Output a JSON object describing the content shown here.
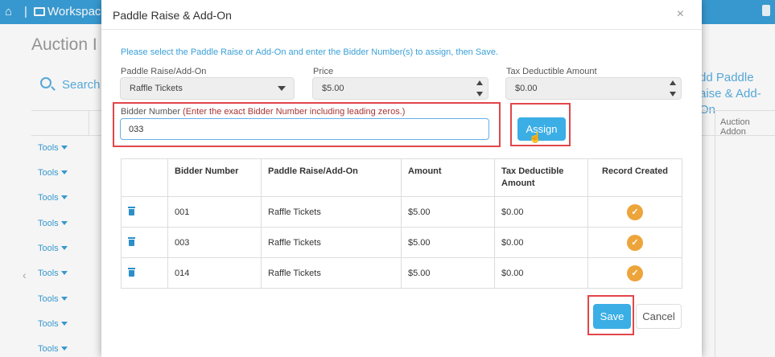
{
  "background": {
    "workspace_label": "Workspace",
    "page_title": "Auction I",
    "search_label": "Search",
    "add_button_line1": "dd Paddle",
    "add_button_line2": "aise & Add-On",
    "column_header": "Auction Addon",
    "tools_label": "Tools"
  },
  "modal": {
    "title": "Paddle Raise & Add-On",
    "close_glyph": "×",
    "instructions": "Please select the Paddle Raise or Add-On and enter the Bidder Number(s) to assign, then Save.",
    "paddle_label": "Paddle Raise/Add-On",
    "paddle_value": "Raffle Tickets",
    "price_label": "Price",
    "price_value": "$5.00",
    "tax_label": "Tax Deductible Amount",
    "tax_value": "$0.00",
    "bidder_label": "Bidder Number",
    "bidder_hint": "(Enter the exact Bidder Number including leading zeros.)",
    "bidder_value": "033",
    "assign_label": "Assign",
    "save_label": "Save",
    "cancel_label": "Cancel"
  },
  "table": {
    "headers": [
      "",
      "Bidder Number",
      "Paddle Raise/Add-On",
      "Amount",
      "Tax Deductible Amount",
      "Record Created"
    ],
    "rows": [
      {
        "bidder": "001",
        "item": "Raffle Tickets",
        "amount": "$5.00",
        "tax": "$0.00"
      },
      {
        "bidder": "003",
        "item": "Raffle Tickets",
        "amount": "$5.00",
        "tax": "$0.00"
      },
      {
        "bidder": "014",
        "item": "Raffle Tickets",
        "amount": "$5.00",
        "tax": "$0.00"
      }
    ]
  },
  "icons": {
    "delete": "trash-icon",
    "record_created": "check-circle-icon",
    "check_glyph": "✓"
  },
  "colors": {
    "accent": "#3aaee5",
    "highlight": "#e1464a",
    "check": "#eda43a"
  }
}
